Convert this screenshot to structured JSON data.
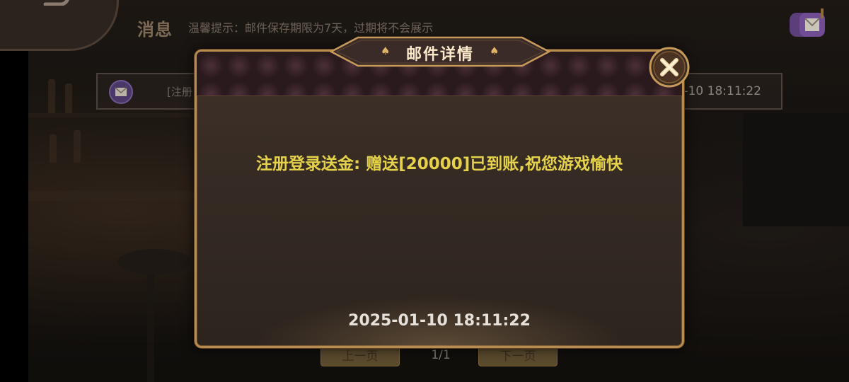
{
  "header": {
    "title": "消息",
    "tip": "温馨提示：邮件保存期限为7天，过期将不会展示"
  },
  "mail_list": {
    "rows": [
      {
        "text": "[注册",
        "date": "-10 18:11:22"
      }
    ]
  },
  "pagination": {
    "prev_label": "上一页",
    "page_indicator": "1/1",
    "next_label": "下一页"
  },
  "dialog": {
    "title": "邮件详情",
    "content": "注册登录送金: 赠送[20000]已到账,祝您游戏愉快",
    "date": "2025-01-10 18:11:22"
  },
  "icons": {
    "back": "back-arrow-icon",
    "mailbox": "mailbox-icon",
    "row_envelope": "envelope-icon",
    "title_decoration": "spade-icon",
    "close": "close-icon"
  },
  "colors": {
    "accent_gold": "#b88c4e",
    "content_yellow": "#e5d24a",
    "title_text": "#fbe9c9"
  }
}
